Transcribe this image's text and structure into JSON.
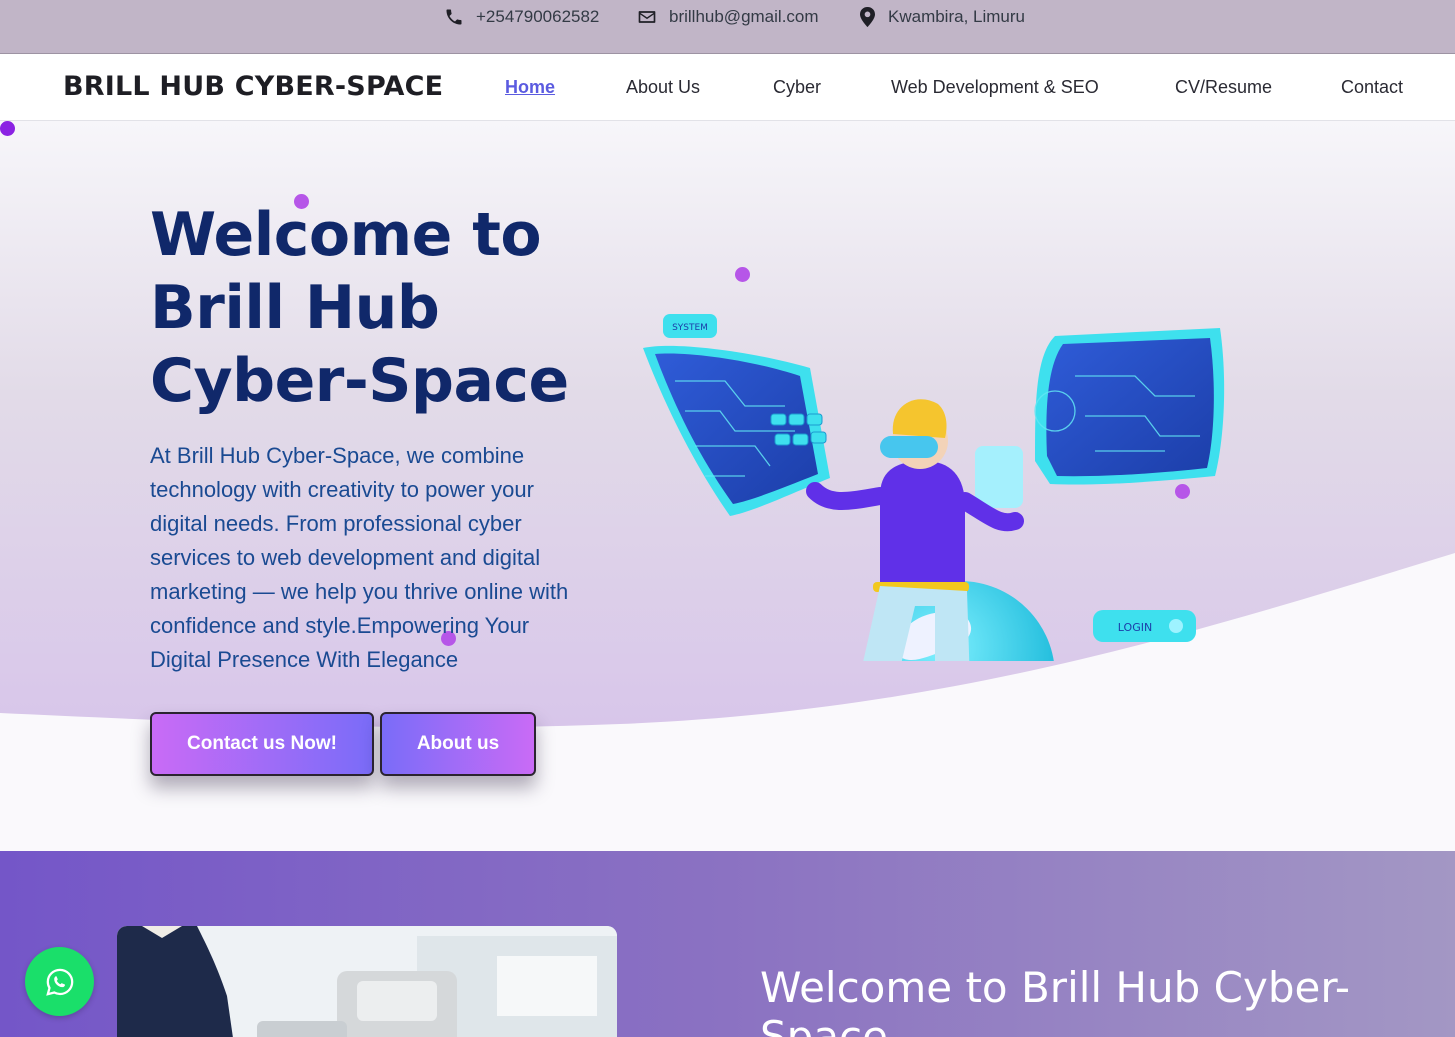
{
  "topbar": {
    "phone": "+254790062582",
    "email": "brillhub@gmail.com",
    "location": "Kwambira, Limuru",
    "icons": [
      "phone-icon",
      "envelope-icon",
      "map-pin-icon"
    ]
  },
  "nav": {
    "brand": "BRILL HUB CYBER-SPACE",
    "links": [
      {
        "label": "Home",
        "active": true
      },
      {
        "label": "About Us",
        "active": false
      },
      {
        "label": "Cyber",
        "active": false
      },
      {
        "label": "Web Development & SEO",
        "active": false
      },
      {
        "label": "CV/Resume",
        "active": false
      },
      {
        "label": "Contact",
        "active": false
      }
    ]
  },
  "hero": {
    "title_lines": [
      "Welcome to",
      "Brill Hub",
      "Cyber-Space"
    ],
    "description": "At Brill Hub Cyber-Space, we combine technology with creativity to power your digital needs. From professional cyber services to web development and digital marketing — we help you thrive online with confidence and style.Empowering Your Digital Presence With Elegance",
    "contact_button": "Contact us Now!",
    "about_button": "About us",
    "illustration_labels": {
      "system": "SYSTEM",
      "login": "LOGIN"
    }
  },
  "section2": {
    "title": "Welcome to Brill Hub Cyber-Space"
  },
  "floating": {
    "whatsapp_icon": "whatsapp-icon"
  },
  "colors": {
    "topbar_bg": "#c1b5c7",
    "title_navy": "#10286a",
    "text_blue": "#1a4a92",
    "active_link": "#5b5be0",
    "section2_start": "#7456c8",
    "whatsapp_green": "#1adf6a"
  }
}
